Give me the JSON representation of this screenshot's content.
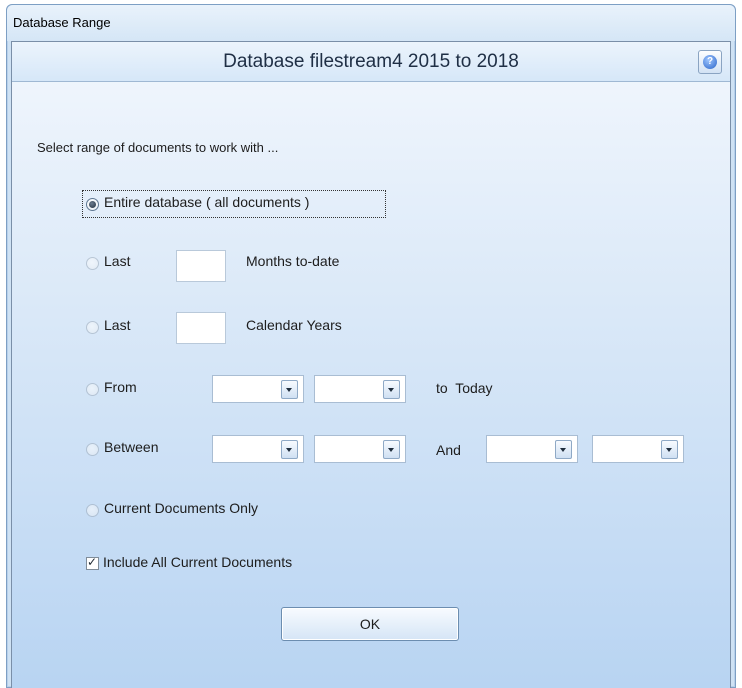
{
  "window": {
    "title": "Database Range"
  },
  "header": {
    "title": "Database filestream4 2015 to 2018",
    "help_icon": "question-mark-icon",
    "help_glyph": "?"
  },
  "instructions": "Select range of documents to work with ...",
  "options": {
    "entire": {
      "label": "Entire database ( all documents )",
      "checked": true
    },
    "last_months": {
      "label": "Last",
      "value": "",
      "suffix": "Months to-date"
    },
    "last_years": {
      "label": "Last",
      "value": "",
      "suffix": "Calendar Years"
    },
    "from": {
      "label": "From",
      "month": "",
      "year": "",
      "suffix": "to  Today"
    },
    "between": {
      "label": "Between",
      "start_month": "",
      "start_year": "",
      "and_label": "And",
      "end_month": "",
      "end_year": ""
    },
    "current_only": {
      "label": "Current Documents Only"
    }
  },
  "include_current": {
    "label": "Include All Current Documents",
    "checked": true,
    "check_glyph": "✓"
  },
  "buttons": {
    "ok": "OK"
  },
  "colors": {
    "panel_top": "#f2f7fd",
    "panel_bottom": "#b8d4f2",
    "header": "#d6e7f8",
    "border": "#7a8fa8"
  }
}
